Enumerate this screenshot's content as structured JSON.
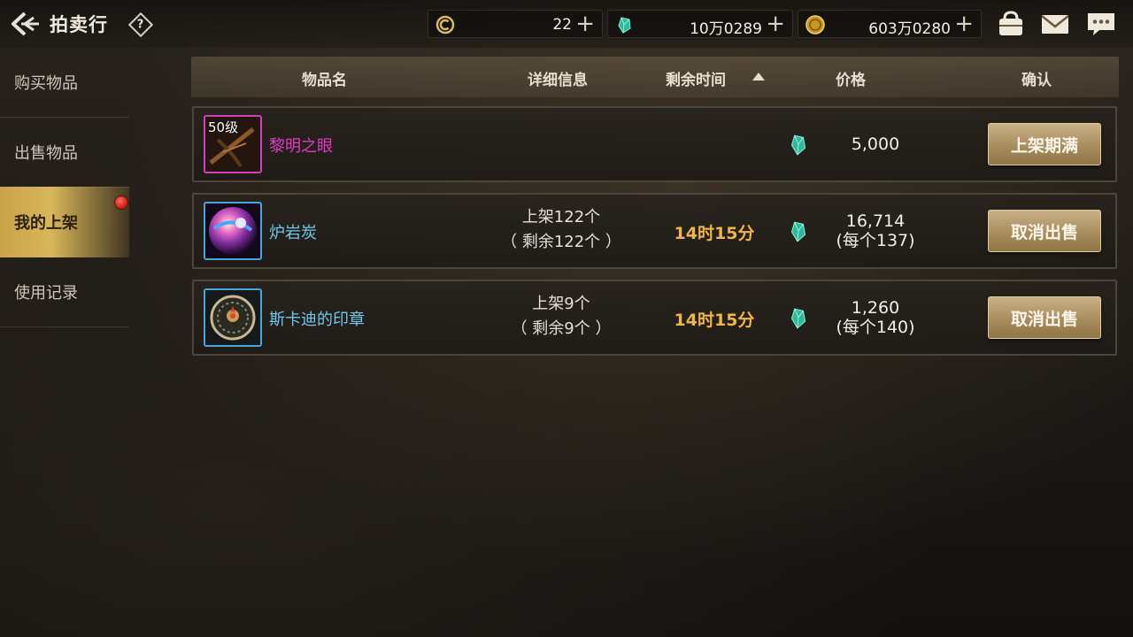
{
  "header": {
    "title": "拍卖行",
    "help_glyph": "?",
    "currencies": [
      {
        "icon": "coin-c-icon",
        "value": "22"
      },
      {
        "icon": "gem-icon",
        "value": "10万0289"
      },
      {
        "icon": "gold-coin-icon",
        "value": "603万0280"
      }
    ],
    "plus": "+"
  },
  "sidebar": {
    "items": [
      {
        "label": "购买物品",
        "active": false
      },
      {
        "label": "出售物品",
        "active": false
      },
      {
        "label": "我的上架",
        "active": true,
        "badge": true
      },
      {
        "label": "使用记录",
        "active": false
      }
    ]
  },
  "table": {
    "headers": {
      "name": "物品名",
      "detail": "详细信息",
      "time": "剩余时间",
      "price": "价格",
      "confirm": "确认"
    },
    "rows": [
      {
        "level": "50级",
        "name": "黎明之眼",
        "name_color": "#e03cc8",
        "detail_line1": "",
        "detail_line2": "",
        "time": "",
        "price": "5,000",
        "price_each": "",
        "action": "上架期满"
      },
      {
        "level": "",
        "name": "炉岩炭",
        "name_color": "#6fc8ea",
        "detail_line1": "上架122个",
        "detail_line2": "（ 剩余122个 ）",
        "time": "14时15分",
        "price": "16,714",
        "price_each": "(每个137)",
        "action": "取消出售"
      },
      {
        "level": "",
        "name": "斯卡迪的印章",
        "name_color": "#6fc8ea",
        "detail_line1": "上架9个",
        "detail_line2": "（ 剩余9个 ）",
        "time": "14时15分",
        "price": "1,260",
        "price_each": "(每个140)",
        "action": "取消出售"
      }
    ]
  }
}
